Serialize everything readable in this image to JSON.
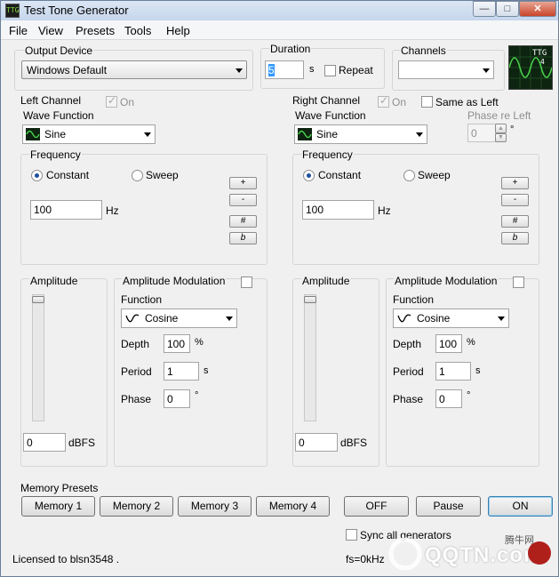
{
  "window": {
    "title": "Test Tone Generator",
    "icon_text": "TTG",
    "controls": {
      "minimize": "—",
      "maximize": "□",
      "close": "✕"
    }
  },
  "menu": [
    "File",
    "View",
    "Presets",
    "Tools",
    "Help"
  ],
  "output_device": {
    "label": "Output Device",
    "value": "Windows Default"
  },
  "duration": {
    "label": "Duration",
    "value": "5",
    "unit": "s",
    "repeat_label": "Repeat",
    "repeat_checked": false
  },
  "channels": {
    "label": "Channels",
    "value": ""
  },
  "logo": {
    "text": "TTG",
    "sub": "4"
  },
  "left": {
    "title": "Left Channel",
    "on_label": "On",
    "wave_label": "Wave Function",
    "wave_value": "Sine",
    "frequency_label": "Frequency",
    "constant_label": "Constant",
    "sweep_label": "Sweep",
    "frequency_value": "100",
    "hz_label": "Hz",
    "buttons": {
      "plus": "+",
      "minus": "-",
      "sharp": "#",
      "flat": "b"
    },
    "amplitude_label": "Amplitude",
    "amplitude_value": "0",
    "dbfs_label": "dBFS",
    "am_label": "Amplitude Modulation",
    "function_label": "Function",
    "function_value": "Cosine",
    "depth_label": "Depth",
    "depth_value": "100",
    "depth_unit": "%",
    "period_label": "Period",
    "period_value": "1",
    "period_unit": "s",
    "phase_label": "Phase",
    "phase_value": "0",
    "phase_unit": "°"
  },
  "right": {
    "title": "Right Channel",
    "on_label": "On",
    "same_as_left_label": "Same as Left",
    "phase_re_left_label": "Phase re Left",
    "phase_re_left_value": "0",
    "phase_re_left_unit": "°",
    "wave_label": "Wave Function",
    "wave_value": "Sine",
    "frequency_label": "Frequency",
    "constant_label": "Constant",
    "sweep_label": "Sweep",
    "frequency_value": "100",
    "hz_label": "Hz",
    "buttons": {
      "plus": "+",
      "minus": "-",
      "sharp": "#",
      "flat": "b"
    },
    "amplitude_label": "Amplitude",
    "amplitude_value": "0",
    "dbfs_label": "dBFS",
    "am_label": "Amplitude Modulation",
    "function_label": "Function",
    "function_value": "Cosine",
    "depth_label": "Depth",
    "depth_value": "100",
    "depth_unit": "%",
    "period_label": "Period",
    "period_value": "1",
    "period_unit": "s",
    "phase_label": "Phase",
    "phase_value": "0",
    "phase_unit": "°"
  },
  "memory": {
    "label": "Memory Presets",
    "buttons": [
      "Memory 1",
      "Memory 2",
      "Memory 3",
      "Memory 4"
    ]
  },
  "transport": {
    "off": "OFF",
    "pause": "Pause",
    "on": "ON"
  },
  "sync_label": "Sync all generators",
  "status": {
    "licensed": "Licensed to blsn3548 .",
    "fs": "fs=0kHz"
  },
  "watermark": {
    "text": "QQTN.com",
    "cn": "腾牛网"
  },
  "colors": {
    "accent": "#3c7fb1",
    "scope_bg": "#0d2410",
    "scope_wave": "#48d04a"
  }
}
